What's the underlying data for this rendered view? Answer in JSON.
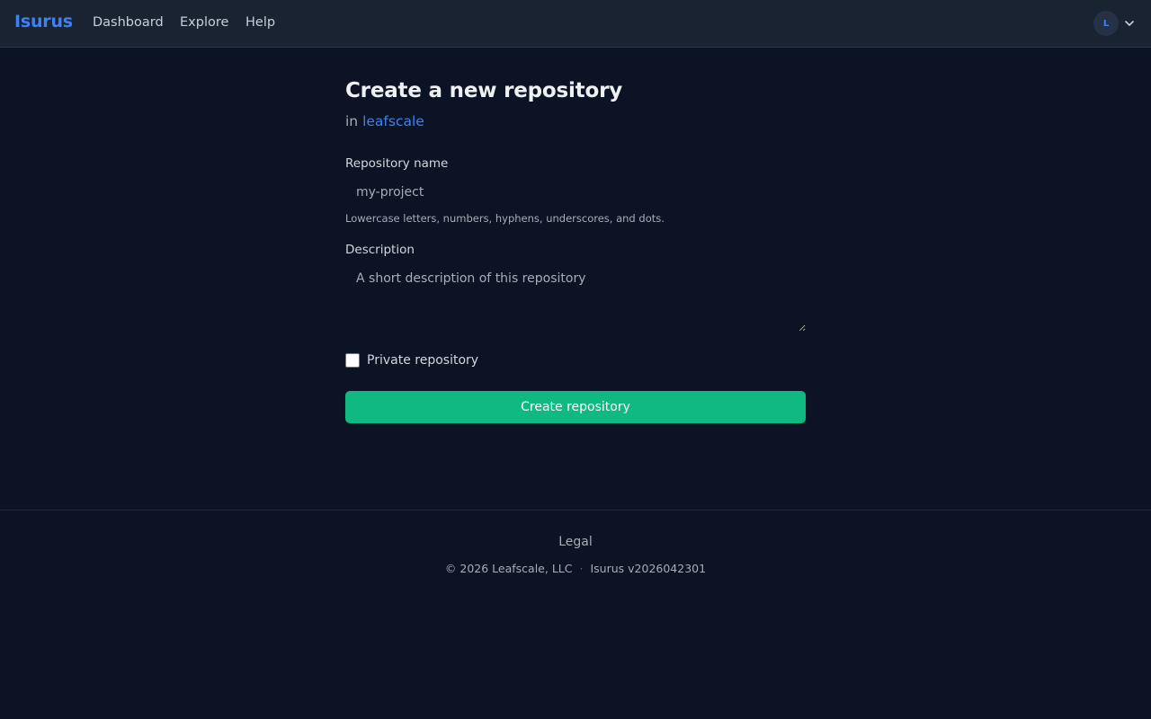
{
  "header": {
    "brand": "Isurus",
    "nav": {
      "dashboard": "Dashboard",
      "explore": "Explore",
      "help": "Help"
    },
    "user": {
      "avatar_initial": "L",
      "menu_icon": "chevron-down-icon"
    }
  },
  "form": {
    "title": "Create a new repository",
    "context_prefix": "in",
    "owner": "leafscale",
    "repo_name": {
      "label": "Repository name",
      "placeholder": "my-project",
      "value": "",
      "hint": "Lowercase letters, numbers, hyphens, underscores, and dots."
    },
    "description": {
      "label": "Description",
      "placeholder": "A short description of this repository",
      "value": ""
    },
    "private": {
      "label": "Private repository",
      "checked": false
    },
    "submit_label": "Create repository"
  },
  "footer": {
    "legal": "Legal",
    "copyright": "© 2026 Leafscale, LLC",
    "separator": "·",
    "version": "Isurus v2026042301"
  },
  "colors": {
    "background": "#0b1324",
    "header": "#1a2332",
    "accent": "#3b82f6",
    "primary_button": "#10b981"
  }
}
